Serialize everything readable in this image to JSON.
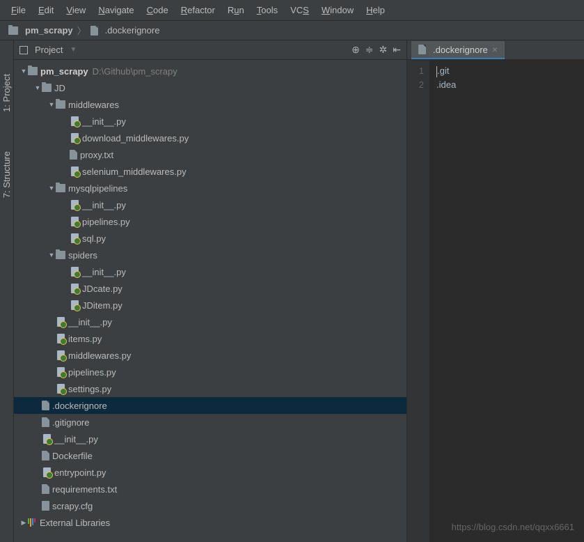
{
  "menu": [
    "File",
    "Edit",
    "View",
    "Navigate",
    "Code",
    "Refactor",
    "Run",
    "Tools",
    "VCS",
    "Window",
    "Help"
  ],
  "breadcrumb": {
    "root": "pm_scrapy",
    "file": ".dockerignore"
  },
  "panel": {
    "title": "Project"
  },
  "tree": {
    "root": {
      "name": "pm_scrapy",
      "path": "D:\\Github\\pm_scrapy"
    },
    "jd": "JD",
    "middlewares": "middlewares",
    "mw_init": "__init__.py",
    "mw_download": "download_middlewares.py",
    "mw_proxy": "proxy.txt",
    "mw_selenium": "selenium_middlewares.py",
    "mysql": "mysqlpipelines",
    "mp_init": "__init__.py",
    "mp_pipe": "pipelines.py",
    "mp_sql": "sql.py",
    "spiders": "spiders",
    "sp_init": "__init__.py",
    "sp_cate": "JDcate.py",
    "sp_item": "JDitem.py",
    "jd_init": "__init__.py",
    "jd_items": "items.py",
    "jd_mw": "middlewares.py",
    "jd_pipe": "pipelines.py",
    "jd_settings": "settings.py",
    "dockerignore": ".dockerignore",
    "gitignore": ".gitignore",
    "root_init": "__init__.py",
    "dockerfile": "Dockerfile",
    "entrypoint": "entrypoint.py",
    "requirements": "requirements.txt",
    "scrapycfg": "scrapy.cfg",
    "external": "External Libraries"
  },
  "sidebar": {
    "project": "1: Project",
    "structure": "7: Structure"
  },
  "editor": {
    "tab": ".dockerignore",
    "lines": {
      "l1": "1",
      "l2": "2"
    },
    "content": {
      "line1": ".git",
      "line2": ".idea"
    }
  },
  "watermark": "https://blog.csdn.net/qqxx6661"
}
